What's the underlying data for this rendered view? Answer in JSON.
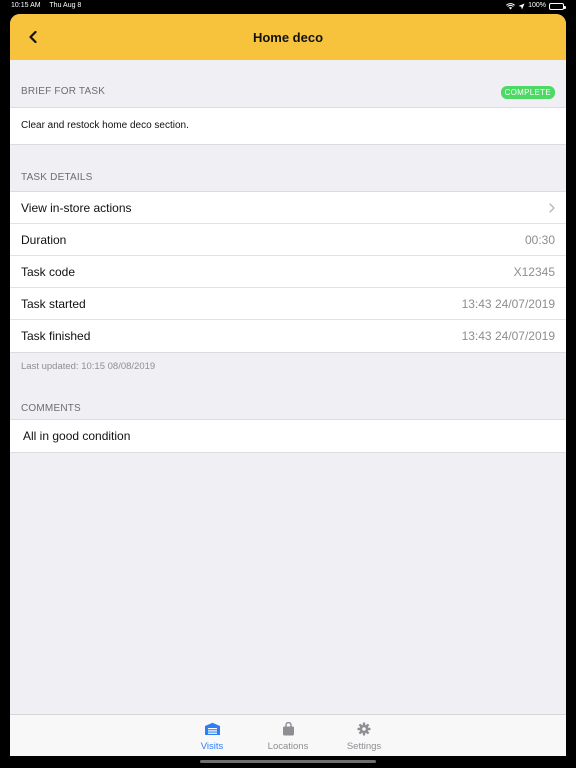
{
  "status_bar": {
    "time": "10:15 AM",
    "date": "Thu Aug 8",
    "battery": "100%"
  },
  "nav": {
    "title": "Home deco",
    "back_icon": "chevron-left-icon"
  },
  "brief": {
    "header": "BRIEF FOR TASK",
    "status": "COMPLETE",
    "text": "Clear and restock home deco section."
  },
  "details": {
    "header": "TASK DETAILS",
    "rows": [
      {
        "label": "View in-store actions",
        "value": ""
      },
      {
        "label": "Duration",
        "value": "00:30"
      },
      {
        "label": "Task code",
        "value": "X12345"
      },
      {
        "label": "Task started",
        "value": "13:43 24/07/2019"
      },
      {
        "label": "Task finished",
        "value": "13:43 24/07/2019"
      }
    ],
    "last_updated": "Last updated: 10:15 08/08/2019"
  },
  "comments": {
    "header": "COMMENTS",
    "text": "All in good condition"
  },
  "tabs": [
    {
      "label": "Visits",
      "icon": "store-icon",
      "active": true
    },
    {
      "label": "Locations",
      "icon": "bag-icon",
      "active": false
    },
    {
      "label": "Settings",
      "icon": "gear-icon",
      "active": false
    }
  ],
  "colors": {
    "nav_background": "#f7c33d",
    "status_badge": "#4cd964",
    "tab_active": "#2f7ff4",
    "tab_inactive": "#8e8e93"
  }
}
